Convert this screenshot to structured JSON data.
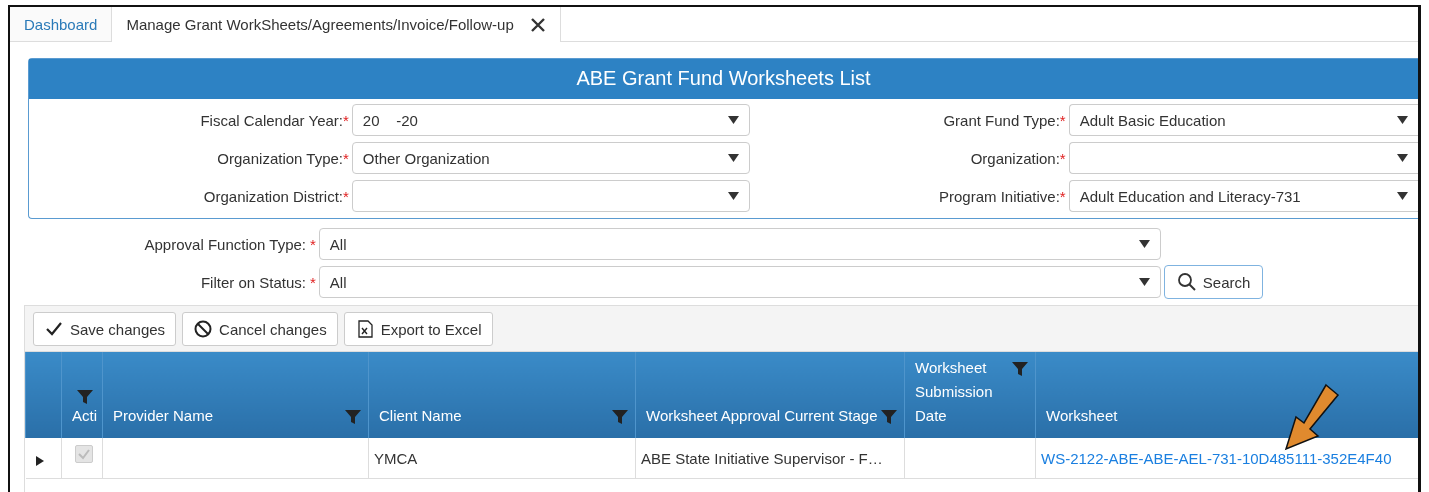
{
  "tabs": [
    {
      "label": "Dashboard",
      "selected": false,
      "closable": false
    },
    {
      "label": "Manage Grant WorkSheets/Agreements/Invoice/Follow-up",
      "selected": true,
      "closable": true
    }
  ],
  "panel": {
    "title": "ABE Grant Fund Worksheets List",
    "left_fields": [
      {
        "label": "Fiscal Calendar Year:",
        "required_mark": "*",
        "value": "20    -20"
      },
      {
        "label": "Organization Type:",
        "required_mark": "*",
        "value": "Other Organization"
      },
      {
        "label": "Organization District:",
        "required_mark": "*"
      }
    ],
    "right_fields": [
      {
        "label": "Grant Fund Type:",
        "required_mark": "*",
        "value": "Adult Basic Education"
      },
      {
        "label": "Organization:",
        "required_mark": "*"
      },
      {
        "label": "Program Initiative:",
        "required_mark": "*",
        "value": "Adult Education and Literacy-731"
      }
    ]
  },
  "filters": [
    {
      "label": "Approval Function Type:",
      "required_mark": "*",
      "value": "All"
    },
    {
      "label": "Filter on Status:",
      "required_mark": "*",
      "value": "All"
    }
  ],
  "search_button": "Search",
  "toolbar": [
    {
      "kind": "check",
      "label": "Save changes"
    },
    {
      "kind": "cancel",
      "label": "Cancel changes"
    },
    {
      "kind": "excel",
      "label": "Export to Excel"
    }
  ],
  "table": {
    "columns": [
      {
        "label": "Acti",
        "filter": true
      },
      {
        "label": "Provider Name",
        "filter": true
      },
      {
        "label": "Client Name",
        "filter": true
      },
      {
        "label": "Worksheet Approval Current Stage",
        "filter": true
      },
      {
        "label": "Worksheet Submission Date",
        "filter": true
      },
      {
        "label": "Worksheet",
        "filter": false
      }
    ],
    "rows": [
      {
        "expanded": false,
        "active": true,
        "client_name": "YMCA",
        "current_stage": "ABE State Initiative Supervisor - F…",
        "worksheet": "WS-2122-ABE-ABE-AEL-731-10D485111-352E4F40"
      }
    ]
  }
}
